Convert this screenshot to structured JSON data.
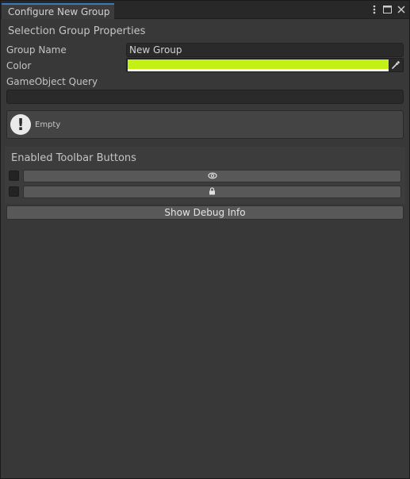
{
  "window": {
    "tab_title": "Configure New Group"
  },
  "section": {
    "title": "Selection Group Properties"
  },
  "fields": {
    "group_name_label": "Group Name",
    "group_name_value": "New Group",
    "color_label": "Color",
    "color_value": "#C3F116",
    "query_label": "GameObject Query",
    "query_value": ""
  },
  "help": {
    "message": "Empty"
  },
  "toolbar": {
    "title": "Enabled Toolbar Buttons",
    "buttons": [
      {
        "icon": "visibility-icon",
        "enabled": false
      },
      {
        "icon": "lock-icon",
        "enabled": false
      }
    ]
  },
  "actions": {
    "debug_label": "Show Debug Info"
  },
  "colors": {
    "accent": "#3A79BB",
    "background": "#383838"
  }
}
